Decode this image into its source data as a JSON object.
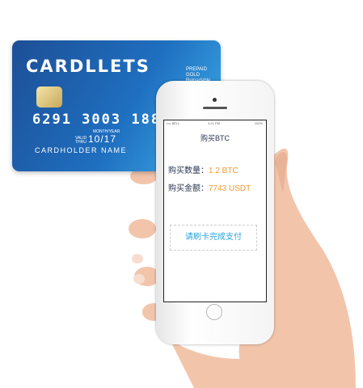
{
  "card": {
    "brand": "CARDLLETS",
    "tier_lines": [
      "PREPAID",
      "GOLD",
      "Reloadable"
    ],
    "number": "6291 3003 1888",
    "expiry_caption": "MONTH/YEAR",
    "valid_thru": "VALID THRU",
    "expiry": "10/17",
    "holder": "CARDHOLDER NAME"
  },
  "phone": {
    "status": {
      "carrier": "•••• BELL",
      "time": "4:21 PM",
      "battery": "100%"
    },
    "title": "购买BTC",
    "rows": [
      {
        "label": "购买数量：",
        "value": "1.2 BTC"
      },
      {
        "label": "购买金额：",
        "value": "7743 USDT"
      }
    ],
    "prompt": "请刷卡完成支付"
  },
  "colors": {
    "accent": "#f39a2d",
    "prompt": "#29a3e0",
    "card_blue": "#1f6fc0",
    "skin": "#f2c5ab"
  }
}
